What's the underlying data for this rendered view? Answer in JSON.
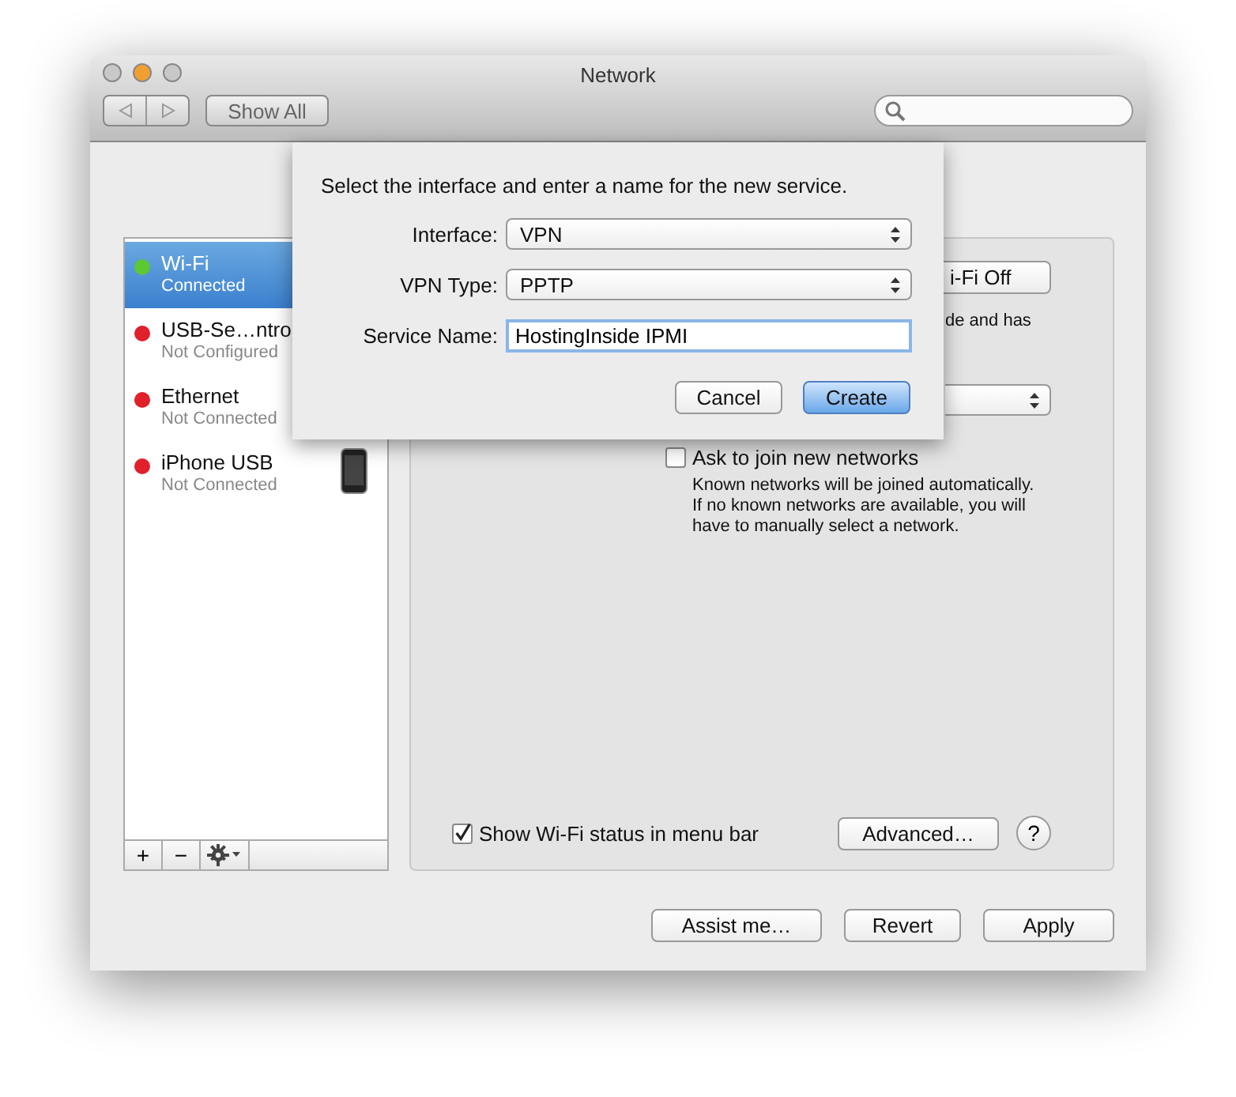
{
  "window": {
    "title": "Network",
    "traffic_lights": [
      {
        "color": "#c8c8c8"
      },
      {
        "color": "#f0a030"
      },
      {
        "color": "#c8c8c8"
      }
    ],
    "show_all": "Show All"
  },
  "sidebar": {
    "items": [
      {
        "name": "Wi-Fi",
        "status": "Connected",
        "color": "#5cc832",
        "selected": true,
        "kind": "wifi"
      },
      {
        "name": "USB-Se…ntro",
        "status": "Not Configured",
        "color": "#e0202a",
        "selected": false,
        "kind": "serial"
      },
      {
        "name": "Ethernet",
        "status": "Not Connected",
        "color": "#e0202a",
        "selected": false,
        "kind": "ethernet"
      },
      {
        "name": "iPhone USB",
        "status": "Not Connected",
        "color": "#e0202a",
        "selected": false,
        "kind": "phone"
      }
    ],
    "toolbar": [
      "+",
      "−"
    ]
  },
  "panel": {
    "power_button": "i-Fi Off",
    "status_fragment": "de and has",
    "ask_to_join": {
      "label": "Ask to join new networks",
      "checked": false
    },
    "ask_note": "Known networks will be joined automatically. If no known networks are available, you will have to manually select a network.",
    "show_status": {
      "label": "Show Wi-Fi status in menu bar",
      "checked": true
    },
    "advanced": "Advanced…",
    "help": "?"
  },
  "buttons": [
    "Assist me…",
    "Revert",
    "Apply"
  ],
  "sheet": {
    "message": "Select the interface and enter a name for the new service.",
    "fields": [
      {
        "label": "Interface:",
        "kind": "popup",
        "value": "VPN"
      },
      {
        "label": "VPN Type:",
        "kind": "popup",
        "value": "PPTP"
      },
      {
        "label": "Service Name:",
        "kind": "text",
        "value": "HostingInside IPMI"
      }
    ],
    "buttons": [
      {
        "label": "Cancel",
        "default": false
      },
      {
        "label": "Create",
        "default": true
      }
    ]
  }
}
